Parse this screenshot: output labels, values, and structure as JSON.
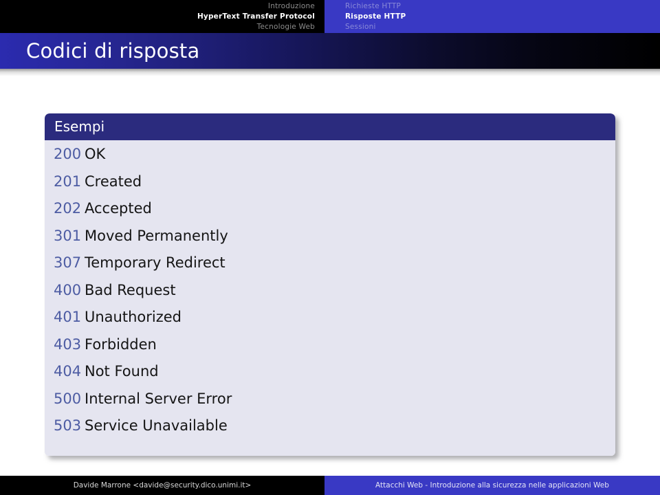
{
  "navigation": {
    "left_section": [
      {
        "label": "Introduzione",
        "active": false
      },
      {
        "label": "HyperText Transfer Protocol",
        "active": true
      },
      {
        "label": "Tecnologie Web",
        "active": false
      }
    ],
    "right_section": [
      {
        "label": "Richieste HTTP",
        "active": false
      },
      {
        "label": "Risposte HTTP",
        "active": true
      },
      {
        "label": "Sessioni",
        "active": false
      }
    ]
  },
  "slide": {
    "title": "Codici di risposta",
    "block": {
      "heading": "Esempi",
      "rows": [
        {
          "code": "200",
          "description": "OK"
        },
        {
          "code": "201",
          "description": "Created"
        },
        {
          "code": "202",
          "description": "Accepted"
        },
        {
          "code": "301",
          "description": "Moved Permanently"
        },
        {
          "code": "307",
          "description": "Temporary Redirect"
        },
        {
          "code": "400",
          "description": "Bad Request"
        },
        {
          "code": "401",
          "description": "Unauthorized"
        },
        {
          "code": "403",
          "description": "Forbidden"
        },
        {
          "code": "404",
          "description": "Not Found"
        },
        {
          "code": "500",
          "description": "Internal Server Error"
        },
        {
          "code": "503",
          "description": "Service Unavailable"
        }
      ]
    }
  },
  "footer": {
    "author": "Davide Marrone <davide@security.dico.unimi.it>",
    "presentation_title": "Attacchi Web - Introduzione alla sicurezza nelle applicazioni Web"
  },
  "colors": {
    "nav_active_blue": "#3939c4",
    "nav_inactive_text": "#8a8ad8",
    "block_header": "#2b2b7e",
    "block_body": "#e5e5f0",
    "code_number": "#4d5ca3",
    "title_text": "#ffffff"
  }
}
